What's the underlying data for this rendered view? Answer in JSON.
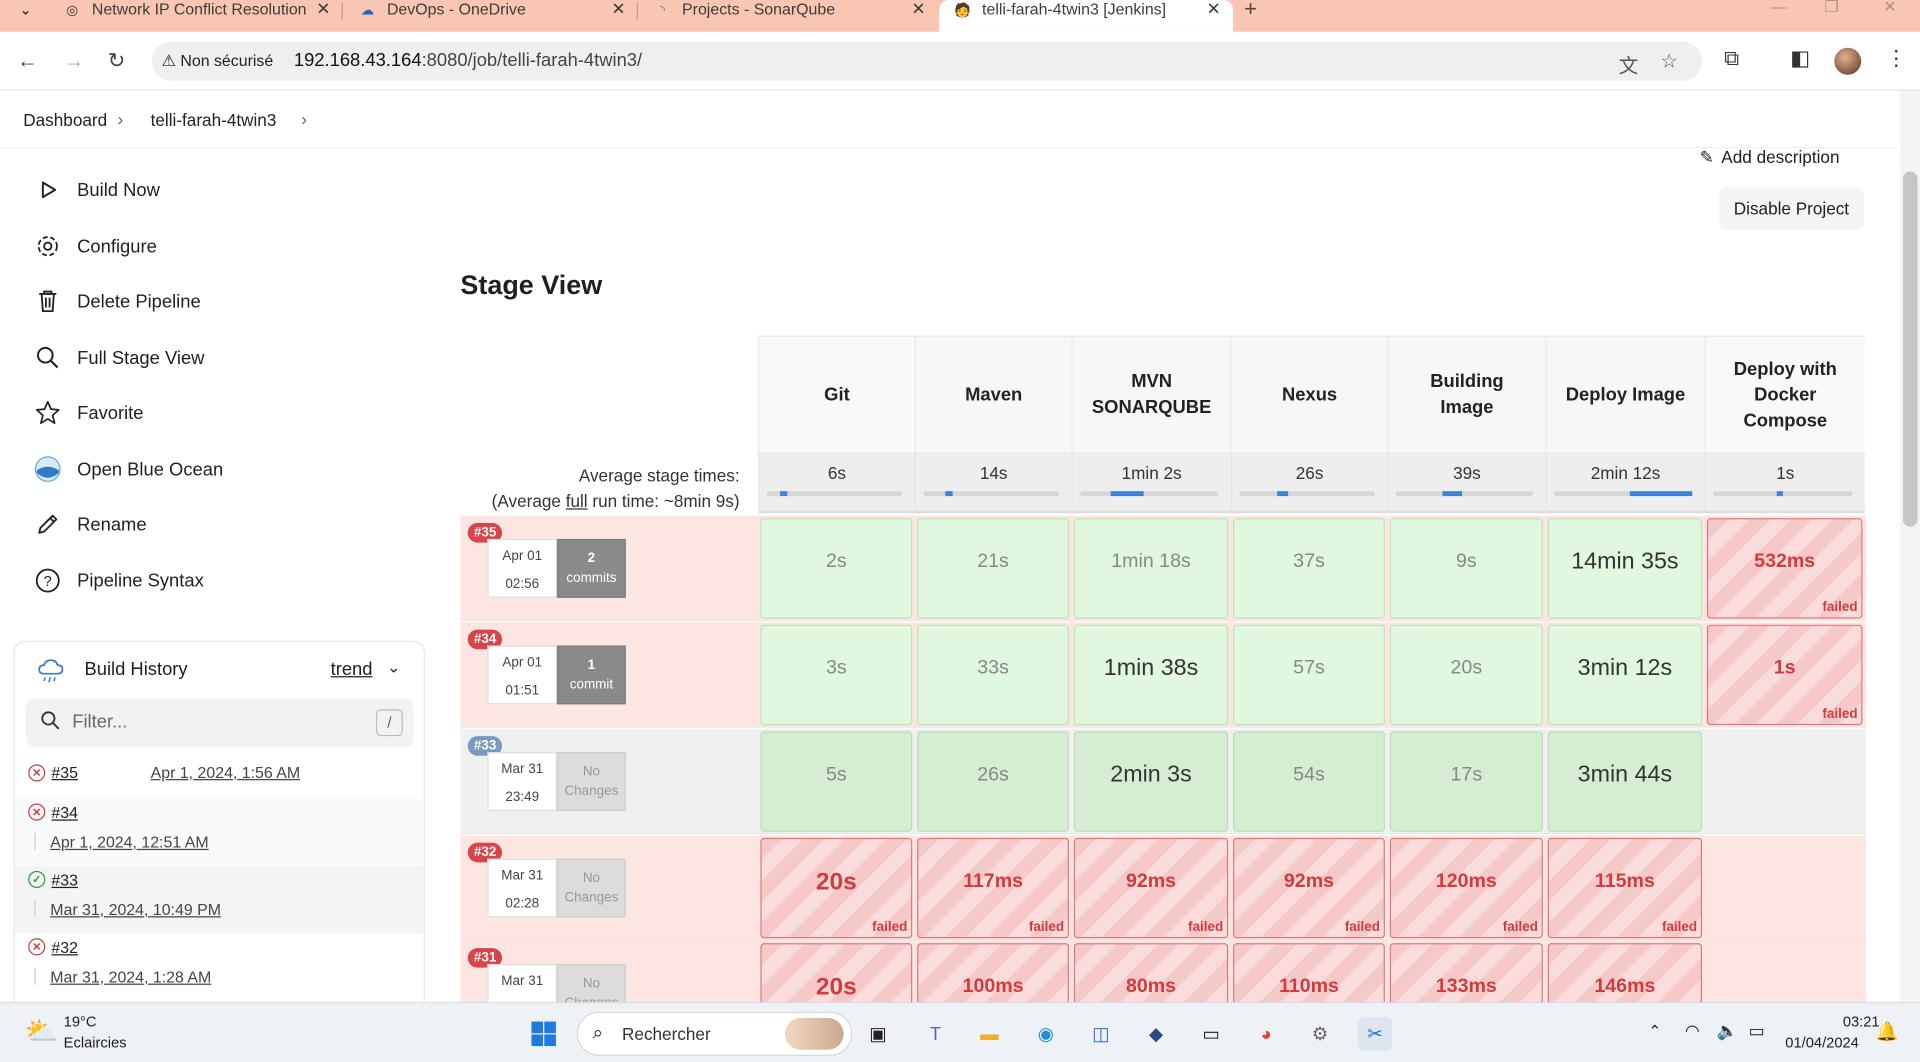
{
  "browser": {
    "tabs": [
      {
        "title": "Network IP Conflict Resolution",
        "icon": "chat-icon"
      },
      {
        "title": "DevOps - OneDrive",
        "icon": "cloud-icon"
      },
      {
        "title": "Projects - SonarQube",
        "icon": "sonarqube-icon"
      },
      {
        "title": "telli-farah-4twin3 [Jenkins]",
        "icon": "jenkins-icon"
      }
    ],
    "security_label": "Non sécurisé",
    "url_host": "192.168.43.164",
    "url_rest": ":8080/job/telli-farah-4twin3/"
  },
  "breadcrumb": {
    "home": "Dashboard",
    "job": "telli-farah-4twin3"
  },
  "sidebar": {
    "items": [
      {
        "label": "Build Now",
        "icon": "play-icon"
      },
      {
        "label": "Configure",
        "icon": "gear-icon"
      },
      {
        "label": "Delete Pipeline",
        "icon": "trash-icon"
      },
      {
        "label": "Full Stage View",
        "icon": "search-icon"
      },
      {
        "label": "Favorite",
        "icon": "star-icon"
      },
      {
        "label": "Open Blue Ocean",
        "icon": "blue-ocean-icon"
      },
      {
        "label": "Rename",
        "icon": "pencil-icon"
      },
      {
        "label": "Pipeline Syntax",
        "icon": "help-icon"
      }
    ]
  },
  "build_history": {
    "title": "Build History",
    "trend": "trend",
    "filter_placeholder": "Filter...",
    "shortcut": "/",
    "builds": [
      {
        "number": "#35",
        "date": "Apr 1, 2024, 1:56 AM",
        "status": "failed"
      },
      {
        "number": "#34",
        "date": "Apr 1, 2024, 12:51 AM",
        "status": "failed"
      },
      {
        "number": "#33",
        "date": "Mar 31, 2024, 10:49 PM",
        "status": "success"
      },
      {
        "number": "#32",
        "date": "Mar 31, 2024, 1:28 AM",
        "status": "failed"
      }
    ]
  },
  "actions": {
    "add_description": "Add description",
    "disable_project": "Disable Project"
  },
  "stage_view": {
    "title": "Stage View",
    "avg_label_1": "Average stage times:",
    "avg_label_2a": "(Average ",
    "avg_label_2b": "full",
    "avg_label_2c": " run time: ~8min 9s)",
    "stages": [
      {
        "name": "Git",
        "avg": "6s",
        "avg_fraction": 0.05
      },
      {
        "name": "Maven",
        "avg": "14s",
        "avg_fraction": 0.06
      },
      {
        "name": "MVN SONARQUBE",
        "avg": "1min 2s",
        "avg_fraction": 0.24
      },
      {
        "name": "Nexus",
        "avg": "26s",
        "avg_fraction": 0.08
      },
      {
        "name": "Building Image",
        "avg": "39s",
        "avg_fraction": 0.14
      },
      {
        "name": "Deploy Image",
        "avg": "2min 12s",
        "avg_fraction": 0.5
      },
      {
        "name": "Deploy with Docker Compose",
        "avg": "1s",
        "avg_fraction": 0.01
      }
    ],
    "failed_label": "failed",
    "runs": [
      {
        "badge": "#35",
        "date": "Apr 01",
        "time": "02:56",
        "commits_n": "2",
        "commits_label": "commits",
        "status": "failed",
        "cells": [
          {
            "v": "2s",
            "s": "ok"
          },
          {
            "v": "21s",
            "s": "ok"
          },
          {
            "v": "1min 18s",
            "s": "ok"
          },
          {
            "v": "37s",
            "s": "ok"
          },
          {
            "v": "9s",
            "s": "ok"
          },
          {
            "v": "14min 35s",
            "s": "okbig"
          },
          {
            "v": "532ms",
            "s": "fail"
          }
        ]
      },
      {
        "badge": "#34",
        "date": "Apr 01",
        "time": "01:51",
        "commits_n": "1",
        "commits_label": "commit",
        "status": "failed",
        "cells": [
          {
            "v": "3s",
            "s": "ok"
          },
          {
            "v": "33s",
            "s": "ok"
          },
          {
            "v": "1min 38s",
            "s": "okbig"
          },
          {
            "v": "57s",
            "s": "ok"
          },
          {
            "v": "20s",
            "s": "ok"
          },
          {
            "v": "3min 12s",
            "s": "okbig"
          },
          {
            "v": "1s",
            "s": "fail"
          }
        ]
      },
      {
        "badge": "#33",
        "date": "Mar 31",
        "time": "23:49",
        "commits_n": "No",
        "commits_label": "Changes",
        "status": "success",
        "cells": [
          {
            "v": "5s",
            "s": "okd"
          },
          {
            "v": "26s",
            "s": "okd"
          },
          {
            "v": "2min 3s",
            "s": "okdbig"
          },
          {
            "v": "54s",
            "s": "okd"
          },
          {
            "v": "17s",
            "s": "okd"
          },
          {
            "v": "3min 44s",
            "s": "okdbig"
          }
        ]
      },
      {
        "badge": "#32",
        "date": "Mar 31",
        "time": "02:28",
        "commits_n": "No",
        "commits_label": "Changes",
        "status": "failed",
        "cells": [
          {
            "v": "20s",
            "s": "failbig"
          },
          {
            "v": "117ms",
            "s": "fail"
          },
          {
            "v": "92ms",
            "s": "fail"
          },
          {
            "v": "92ms",
            "s": "fail"
          },
          {
            "v": "120ms",
            "s": "fail"
          },
          {
            "v": "115ms",
            "s": "fail"
          }
        ]
      },
      {
        "badge": "#31",
        "date": "Mar 31",
        "time": "",
        "commits_n": "No",
        "commits_label": "Changes",
        "status": "failed",
        "cells": [
          {
            "v": "20s",
            "s": "failbig"
          },
          {
            "v": "100ms",
            "s": "fail"
          },
          {
            "v": "80ms",
            "s": "fail"
          },
          {
            "v": "110ms",
            "s": "fail"
          },
          {
            "v": "133ms",
            "s": "fail"
          },
          {
            "v": "146ms",
            "s": "fail"
          }
        ]
      }
    ]
  },
  "taskbar": {
    "weather_temp": "19°C",
    "weather_desc": "Eclaircies",
    "search_placeholder": "Rechercher",
    "time": "03:21",
    "date": "01/04/2024"
  },
  "colors": {
    "fail_badge": "#d9434a",
    "success_badge": "#7a98c0",
    "fail_row": "#fde5e1",
    "ok_row": "#f0f0f0",
    "commits_bg": "#8a8a8a",
    "nochange_bg": "#dcdcdc"
  }
}
